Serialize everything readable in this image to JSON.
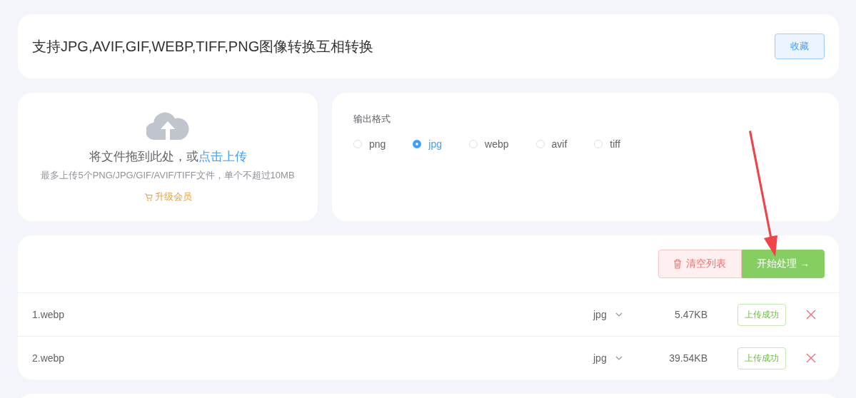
{
  "header": {
    "title": "支持JPG,AVIF,GIF,WEBP,TIFF,PNG图像转换互相转换",
    "favorite_button": "收藏"
  },
  "upload": {
    "drop_text": "将文件拖到此处，或",
    "drop_link": "点击上传",
    "hint": "最多上传5个PNG/JPG/GIF/AVIF/TIFF文件，单个不超过10MB",
    "upgrade_link": "升级会员"
  },
  "output": {
    "label": "输出格式",
    "options": [
      {
        "label": "png",
        "selected": false
      },
      {
        "label": "jpg",
        "selected": true
      },
      {
        "label": "webp",
        "selected": false
      },
      {
        "label": "avif",
        "selected": false
      },
      {
        "label": "tiff",
        "selected": false
      }
    ]
  },
  "actions": {
    "clear_button": "清空列表",
    "start_button": "开始处理",
    "start_arrow": "→"
  },
  "files": [
    {
      "name": "1.webp",
      "format": "jpg",
      "size": "5.47KB",
      "status": "上传成功"
    },
    {
      "name": "2.webp",
      "format": "jpg",
      "size": "39.54KB",
      "status": "上传成功"
    }
  ]
}
